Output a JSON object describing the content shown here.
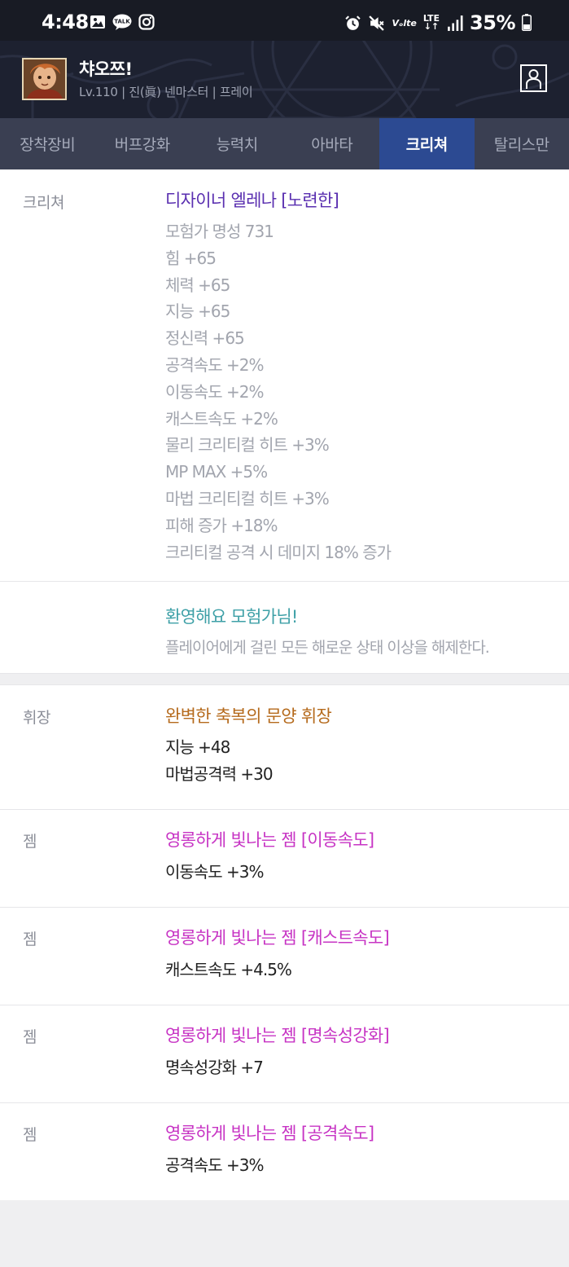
{
  "status_bar": {
    "time": "4:48",
    "left_icons": [
      "gallery-icon",
      "kakaotalk-icon",
      "instagram-icon"
    ],
    "kakao_badge": "TALK",
    "right_icons": [
      "alarm-icon",
      "mute-icon",
      "volte-icon",
      "lte-icon",
      "signal-icon",
      "battery-icon"
    ],
    "volte": "Vₒlte",
    "lte": "LTE",
    "battery": "35%"
  },
  "character": {
    "name": "챠오쯔!",
    "info": "Lv.110 | 진(眞) 넨마스터 | 프레이"
  },
  "tabs": [
    {
      "label": "장착장비",
      "active": false
    },
    {
      "label": "버프강화",
      "active": false
    },
    {
      "label": "능력치",
      "active": false
    },
    {
      "label": "아바타",
      "active": false
    },
    {
      "label": "크리쳐",
      "active": true
    },
    {
      "label": "탈리스만",
      "active": false
    }
  ],
  "colors": {
    "creature_title": "#5a2fb0",
    "skill_title": "#3ea0a7",
    "emblem_title": "#b56a1c",
    "gem_title": "#c734c4",
    "active_tab": "#2c4a92"
  },
  "creature": {
    "label": "크리쳐",
    "name": "디자이너 엘레나 [노련한]",
    "stats": [
      "모험가 명성 731",
      "힘 +65",
      "체력 +65",
      "지능 +65",
      "정신력 +65",
      "공격속도 +2%",
      "이동속도 +2%",
      "캐스트속도 +2%",
      "물리 크리티컬 히트 +3%",
      "MP MAX +5%",
      "마법 크리티컬 히트 +3%",
      "피해 증가 +18%",
      "크리티컬 공격 시 데미지 18% 증가"
    ],
    "skill": {
      "name": "환영해요 모험가님!",
      "desc": "플레이어에게 걸린 모든 해로운 상태 이상을 해제한다."
    }
  },
  "emblem": {
    "label": "휘장",
    "name": "완벽한 축복의 문양 휘장",
    "stats": [
      "지능 +48",
      "마법공격력 +30"
    ]
  },
  "gems": [
    {
      "label": "젬",
      "name": "영롱하게 빛나는 젬 [이동속도]",
      "stat": "이동속도 +3%"
    },
    {
      "label": "젬",
      "name": "영롱하게 빛나는 젬 [캐스트속도]",
      "stat": "캐스트속도 +4.5%"
    },
    {
      "label": "젬",
      "name": "영롱하게 빛나는 젬 [명속성강화]",
      "stat": "명속성강화 +7"
    },
    {
      "label": "젬",
      "name": "영롱하게 빛나는 젬 [공격속도]",
      "stat": "공격속도 +3%"
    }
  ]
}
